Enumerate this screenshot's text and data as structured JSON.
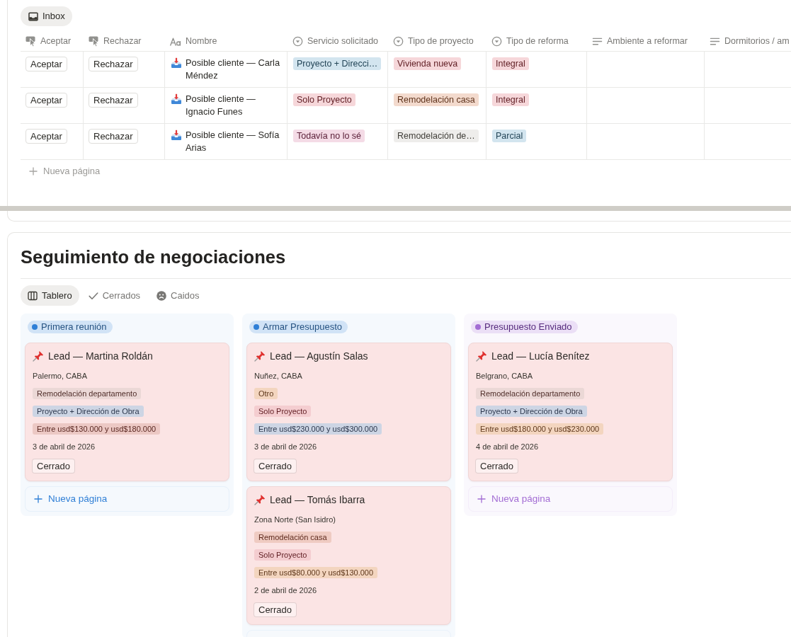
{
  "inbox_tab": {
    "label": "Inbox",
    "selected": true
  },
  "table": {
    "columns": [
      {
        "label": "Aceptar",
        "kind": "button"
      },
      {
        "label": "Rechazar",
        "kind": "button"
      },
      {
        "label": "Nombre",
        "kind": "title"
      },
      {
        "label": "Servicio solicitado",
        "kind": "select"
      },
      {
        "label": "Tipo de proyecto",
        "kind": "select"
      },
      {
        "label": "Tipo de reforma",
        "kind": "select"
      },
      {
        "label": "Ambiente a reformar",
        "kind": "text"
      },
      {
        "label": "Dormitorios / am",
        "kind": "text"
      }
    ],
    "rows": [
      {
        "cells": [
          {
            "text": "Aceptar"
          },
          {
            "text": "Rechazar"
          },
          {
            "text": "Posible cliente — Carla Méndez"
          },
          {
            "label": "Proyecto + Direcci…",
            "color": "#d3e5ef"
          },
          {
            "label": "Vivienda nueva",
            "color": "#f6d7da"
          },
          {
            "label": "Integral",
            "color": "#f6d7da"
          }
        ]
      },
      {
        "cells": [
          {
            "text": "Aceptar"
          },
          {
            "text": "Rechazar"
          },
          {
            "text": "Posible cliente — Ignacio Funes"
          },
          {
            "label": "Solo Proyecto",
            "color": "#f6d7da"
          },
          {
            "label": "Remodelación casa",
            "color": "#f3dacd"
          },
          {
            "label": "Integral",
            "color": "#f6d7da"
          }
        ]
      },
      {
        "cells": [
          {
            "text": "Aceptar"
          },
          {
            "text": "Rechazar"
          },
          {
            "text": "Posible cliente — Sofía Arias"
          },
          {
            "label": "Todavía no lo sé",
            "color": "#f4dbe6"
          },
          {
            "label": "Remodelación de…",
            "color": "#eeedeb"
          },
          {
            "label": "Parcial",
            "color": "#d3e5ef"
          }
        ]
      }
    ],
    "new_row": "Nueva página"
  },
  "board": {
    "title": "Seguimiento de negociaciones",
    "views": [
      {
        "label": "Tablero",
        "kind": "board",
        "selected": true
      },
      {
        "label": "Cerrados",
        "kind": "check",
        "selected": false
      },
      {
        "label": "Caidos",
        "kind": "sad",
        "selected": false
      }
    ],
    "columns": [
      {
        "label": "Primera reunión",
        "color": "#2f7fd6",
        "cards": [
          {
            "title": "Lead — Martina Roldán",
            "location": "Palermo, CABA",
            "tags": [
              {
                "label": "Remodelación departamento",
                "color": "#ebd8d6"
              },
              {
                "label": "Proyecto + Dirección de Obra",
                "color": "#cdd5e4"
              },
              {
                "label": "Entre usd$130.000 y usd$180.000",
                "color": "#ecc8c4"
              }
            ],
            "date": "3 de abril de 2026",
            "button": "Cerrado"
          }
        ],
        "new_page": "Nueva página"
      },
      {
        "label": "Armar Presupuesto",
        "color": "#2f7fd6",
        "cards": [
          {
            "title": "Lead — Agustín Salas",
            "location": "Nuñez, CABA",
            "tags": [
              {
                "label": "Otro",
                "color": "#f3d5bf"
              },
              {
                "label": "Solo Proyecto",
                "color": "#f4cdd0"
              },
              {
                "label": "Entre usd$230.000 y usd$300.000",
                "color": "#cdd5e4"
              }
            ],
            "date": "3 de abril de 2026",
            "button": "Cerrado"
          },
          {
            "title": "Lead — Tomás Ibarra",
            "location": "Zona Norte (San Isidro)",
            "tags": [
              {
                "label": "Remodelación casa",
                "color": "#efcbc2"
              },
              {
                "label": "Solo Proyecto",
                "color": "#f4cdd0"
              },
              {
                "label": "Entre usd$80.000 y usd$130.000",
                "color": "#f3d5bf"
              }
            ],
            "date": "2 de abril de 2026",
            "button": "Cerrado"
          }
        ],
        "cut_off": true
      },
      {
        "label": "Presupuesto Enviado",
        "color": "#a36dd4",
        "cards": [
          {
            "title": "Lead — Lucía Benítez",
            "location": "Belgrano, CABA",
            "tags": [
              {
                "label": "Remodelación departamento",
                "color": "#ebd8d6"
              },
              {
                "label": "Proyecto + Dirección de Obra",
                "color": "#cdd5e4"
              },
              {
                "label": "Entre usd$180.000 y usd$230.000",
                "color": "#f3d5bf"
              }
            ],
            "date": "4 de abril de 2026",
            "button": "Cerrado"
          }
        ],
        "new_page": "Nueva página"
      }
    ]
  }
}
